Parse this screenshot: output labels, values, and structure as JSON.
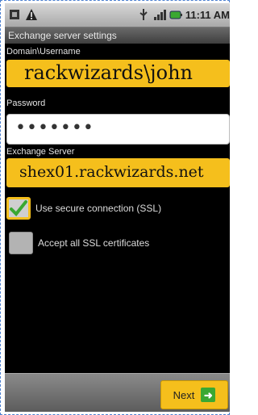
{
  "status_bar": {
    "time": "11:11 AM",
    "icons": [
      "sim-icon",
      "warning-icon",
      "usb-icon",
      "signal-icon",
      "battery-icon"
    ]
  },
  "title": "Exchange server settings",
  "fields": {
    "domain_username": {
      "label": "Domain\\Username",
      "value": "rackwizards\\john"
    },
    "password": {
      "label": "Password",
      "value": "•••••••"
    },
    "exchange_server": {
      "label": "Exchange Server",
      "value": "shex01.rackwizards.net"
    }
  },
  "options": {
    "ssl": {
      "label": "Use secure connection (SSL)",
      "checked": true
    },
    "accept_certs": {
      "label": "Accept all SSL certificates",
      "checked": false
    }
  },
  "buttons": {
    "next": "Next"
  },
  "colors": {
    "highlight": "#f5bf1c",
    "check": "#3aa832",
    "background": "#000000"
  }
}
